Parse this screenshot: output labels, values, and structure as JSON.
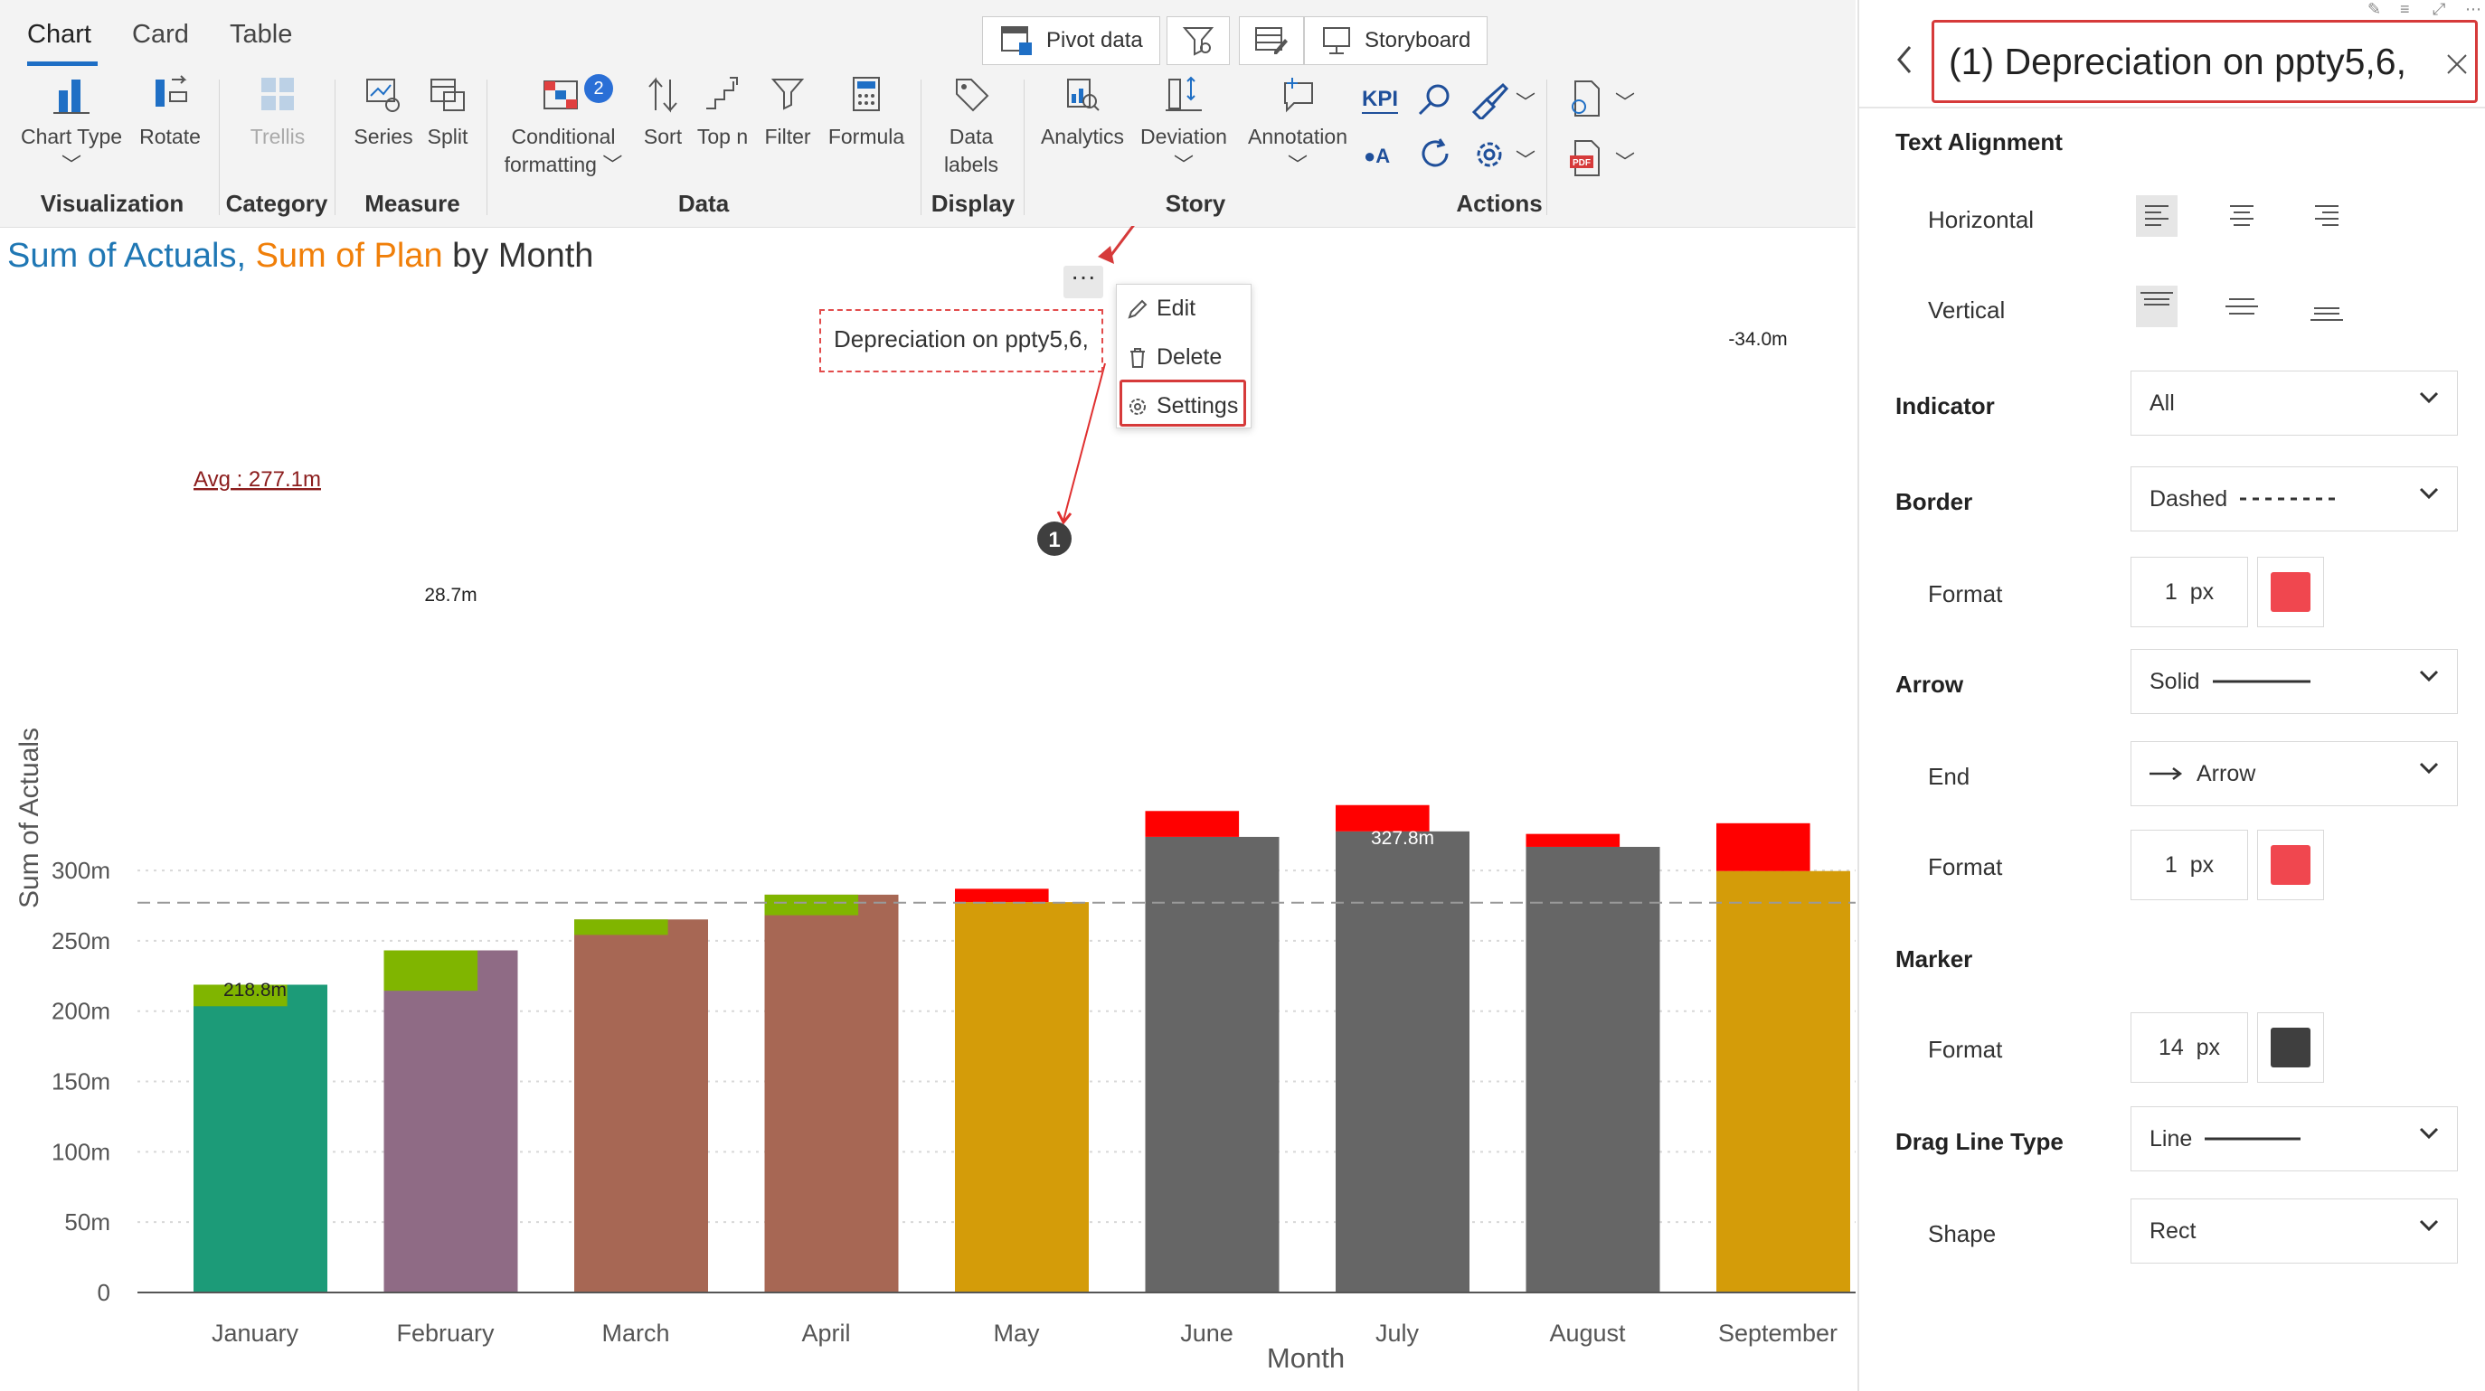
{
  "ribbon": {
    "tabs": [
      "Chart",
      "Card",
      "Table"
    ],
    "top_buttons": {
      "pivot": "Pivot data",
      "storyboard": "Storyboard"
    },
    "buttons": {
      "chart_type": "Chart Type",
      "rotate": "Rotate",
      "trellis": "Trellis",
      "series": "Series",
      "split": "Split",
      "conditional": "Conditional",
      "formatting": "formatting",
      "cf_badge": "2",
      "sort": "Sort",
      "topn": "Top n",
      "filter": "Filter",
      "formula": "Formula",
      "data": "Data",
      "labels": "labels",
      "analytics": "Analytics",
      "deviation": "Deviation",
      "annotation": "Annotation",
      "kpi": "KPI",
      "oa": "A"
    },
    "groups": [
      "Visualization",
      "Category",
      "Measure",
      "Data",
      "Display",
      "Story",
      "Actions"
    ]
  },
  "chart_title": {
    "part1": "Sum of Actuals,",
    "part2": "Sum of Plan",
    "part3": "by Month"
  },
  "context_menu": {
    "edit": "Edit",
    "delete": "Delete",
    "settings": "Settings"
  },
  "annotation": {
    "text": "Depreciation on ppty5,6,",
    "marker": "1"
  },
  "colors": {
    "actual_blue": "#1f77b4",
    "plan_orange": "#f07f09",
    "over_green": "#80b500",
    "under_red": "#ff0000",
    "highlight_red": "#d63a3a"
  },
  "chart_data": {
    "type": "bar",
    "xlabel": "Month",
    "ylabel": "Sum of Actuals",
    "ylim": [
      0,
      340
    ],
    "yticks": [
      "0",
      "50m",
      "100m",
      "150m",
      "200m",
      "250m",
      "300m"
    ],
    "categories": [
      "January",
      "February",
      "March",
      "April",
      "May",
      "June",
      "July",
      "August",
      "September"
    ],
    "series": [
      {
        "name": "Sum of Actuals",
        "values": [
          218.8,
          243.2,
          265.2,
          282.8,
          277.5,
          323.9,
          327.8,
          316.8,
          299.6
        ]
      },
      {
        "name": "Sum of Plan",
        "values": [
          203.5,
          214.5,
          254.2,
          268.2,
          287.0,
          342.3,
          346.5,
          326.0,
          333.6
        ]
      }
    ],
    "bar_colors": [
      "#1c9b78",
      "#8f6b85",
      "#a76754",
      "#a76754",
      "#d49c09",
      "#666666",
      "#666666",
      "#666666",
      "#d49c09"
    ],
    "data_labels": [
      {
        "month": "January",
        "text": "218.8m"
      },
      {
        "month": "February",
        "text": "28.7m"
      },
      {
        "month": "July",
        "text": "327.8m"
      },
      {
        "month": "September",
        "text": "-34.0m"
      }
    ],
    "average": {
      "label": "Avg : 277.1m",
      "value": 277.1
    }
  },
  "panel": {
    "title": "(1) Depreciation on ppty5,6,",
    "text_alignment": "Text Alignment",
    "horizontal": "Horizontal",
    "vertical": "Vertical",
    "indicator": {
      "label": "Indicator",
      "value": "All"
    },
    "border": {
      "label": "Border",
      "value": "Dashed"
    },
    "border_format": {
      "label": "Format",
      "value": "1",
      "unit": "px",
      "color": "#f0474f"
    },
    "arrow": {
      "label": "Arrow",
      "value": "Solid"
    },
    "end": {
      "label": "End",
      "value": "Arrow"
    },
    "arrow_format": {
      "label": "Format",
      "value": "1",
      "unit": "px",
      "color": "#f0474f"
    },
    "marker": "Marker",
    "marker_format": {
      "label": "Format",
      "value": "14",
      "unit": "px",
      "color": "#3f3f3f"
    },
    "drag_line_type": {
      "label": "Drag Line Type",
      "value": "Line"
    },
    "shape": {
      "label": "Shape",
      "value": "Rect"
    }
  }
}
